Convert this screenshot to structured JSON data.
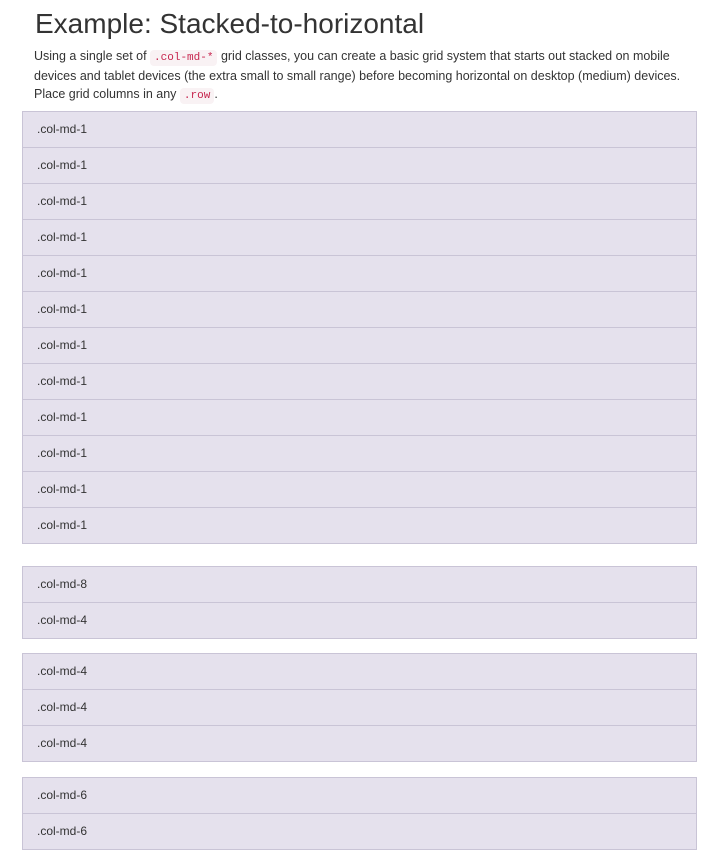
{
  "heading": {
    "title": "Example: Stacked-to-horizontal"
  },
  "description": {
    "text_1": "Using a single set of ",
    "code_1": ".col-md-*",
    "text_2": " grid classes, you can create a basic grid system that starts out stacked on mobile devices and tablet devices (the extra small to small range) before becoming horizontal on desktop (medium) devices. Place grid columns in any ",
    "code_2": ".row",
    "text_3": "."
  },
  "rows": [
    {
      "cells": [
        ".col-md-1",
        ".col-md-1",
        ".col-md-1",
        ".col-md-1",
        ".col-md-1",
        ".col-md-1",
        ".col-md-1",
        ".col-md-1",
        ".col-md-1",
        ".col-md-1",
        ".col-md-1",
        ".col-md-1"
      ]
    },
    {
      "cells": [
        ".col-md-8",
        ".col-md-4"
      ]
    },
    {
      "cells": [
        ".col-md-4",
        ".col-md-4",
        ".col-md-4"
      ]
    },
    {
      "cells": [
        ".col-md-6",
        ".col-md-6"
      ]
    }
  ],
  "colors": {
    "cell_background": "#e5e1ed",
    "cell_border": "#c9c4d6",
    "code_text": "#c7254e",
    "code_background": "#f9f2f4"
  }
}
